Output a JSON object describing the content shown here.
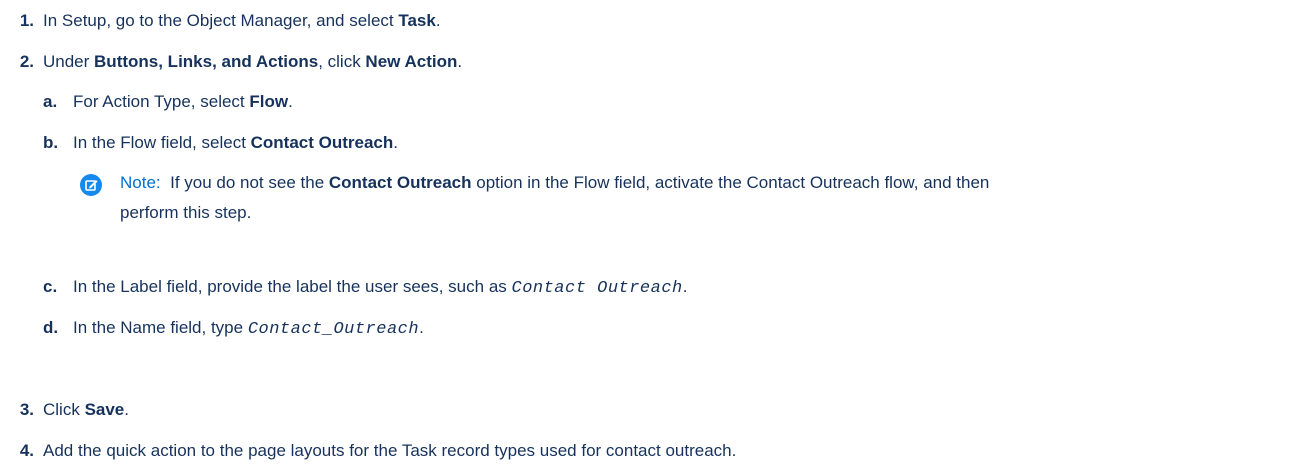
{
  "steps": {
    "s1": {
      "num": "1.",
      "pre": "In Setup, go to the Object Manager, and select ",
      "b1": "Task",
      "post": "."
    },
    "s2": {
      "num": "2.",
      "pre": "Under ",
      "b1": "Buttons, Links, and Actions",
      "mid": ", click ",
      "b2": "New Action",
      "post": "."
    },
    "sa": {
      "num": "a.",
      "pre": "For Action Type, select ",
      "b1": "Flow",
      "post": "."
    },
    "sb": {
      "num": "b.",
      "pre": "In the Flow field, select ",
      "b1": "Contact Outreach",
      "post": "."
    },
    "sc": {
      "num": "c.",
      "pre": "In the Label field, provide the label the user sees, such as ",
      "code": "Contact Outreach",
      "post": "."
    },
    "sd": {
      "num": "d.",
      "pre": "In the Name field, type ",
      "code": "Contact_Outreach",
      "post": "."
    },
    "s3": {
      "num": "3.",
      "pre": "Click ",
      "b1": "Save",
      "post": "."
    },
    "s4": {
      "num": "4.",
      "text": "Add the quick action to the page layouts for the Task record types used for contact outreach."
    }
  },
  "note": {
    "icon": "edit-note-icon",
    "label": "Note:",
    "pre": "If you do not see the ",
    "b1": "Contact Outreach",
    "post": " option in the Flow field, activate the Contact Outreach flow, and then",
    "line2": "perform this step."
  },
  "colors": {
    "text": "#16325c",
    "accent": "#0070d2"
  }
}
